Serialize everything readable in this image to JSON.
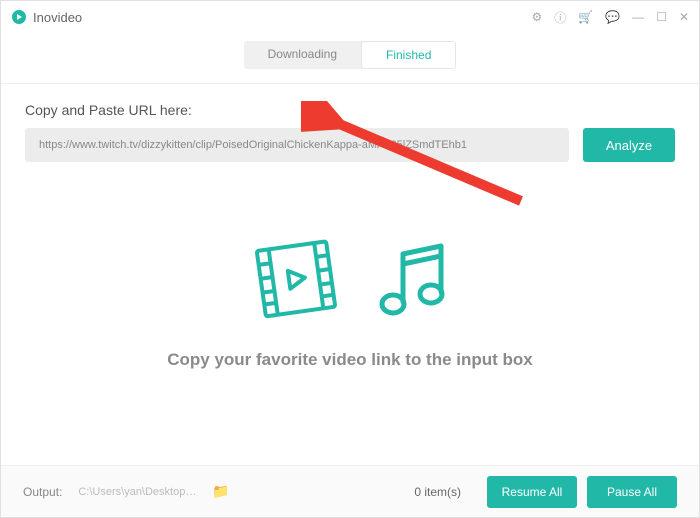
{
  "app": {
    "title": "Inovideo"
  },
  "tabs": {
    "downloading": "Downloading",
    "finished": "Finished",
    "active": "finished"
  },
  "url": {
    "label": "Copy and Paste URL here:",
    "value": "https://www.twitch.tv/dizzykitten/clip/PoisedOriginalChickenKappa-aMA465lZSmdTEhb1",
    "analyze": "Analyze"
  },
  "empty": {
    "hint": "Copy your favorite video link to the input box"
  },
  "footer": {
    "output_label": "Output:",
    "path": "C:\\Users\\yan\\Desktop\\te...",
    "item_count": "0 item(s)",
    "resume": "Resume All",
    "pause": "Pause All"
  },
  "colors": {
    "accent": "#22b8a8",
    "arrow": "#ed3b2f"
  }
}
